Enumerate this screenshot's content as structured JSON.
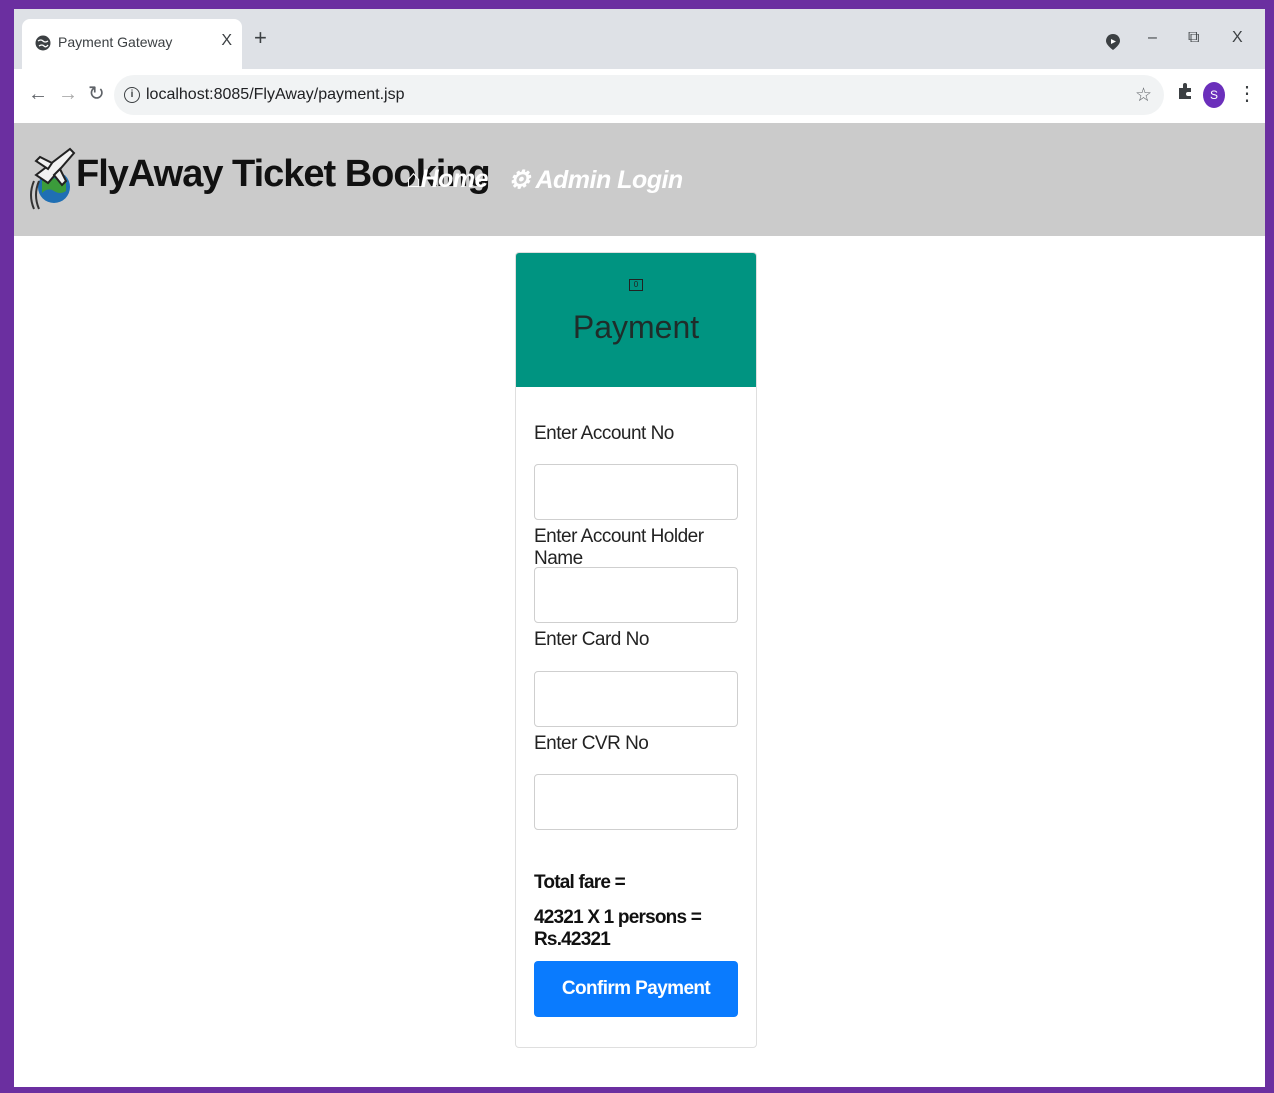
{
  "browser": {
    "tab_title": "Payment Gateway",
    "tab_close": "X",
    "new_tab": "+",
    "window_minimize": "–",
    "window_restore": "⧉",
    "window_close": "X",
    "url": "localhost:8085/FlyAway/payment.jsp",
    "profile_initial": "S"
  },
  "navbar": {
    "brand": "FlyAway Ticket Booking",
    "links": [
      {
        "label": "Home",
        "icon": "home-icon"
      },
      {
        "label": "Admin Login",
        "icon": "gear-icon"
      }
    ]
  },
  "payment_form": {
    "title": "Payment",
    "icon": "money-icon",
    "fields": [
      {
        "label": "Enter Account No",
        "value": "",
        "placeholder": ""
      },
      {
        "label": "Enter Account Holder Name",
        "value": "",
        "placeholder": ""
      },
      {
        "label": "Enter Card No",
        "value": "",
        "placeholder": ""
      },
      {
        "label": "Enter CVR No",
        "value": "",
        "placeholder": ""
      }
    ],
    "total_fare_label": "Total fare =",
    "total_fare_calc": "42321 X 1 persons = Rs.42321",
    "confirm_label": "Confirm Payment"
  },
  "colors": {
    "frame": "#6b2fa0",
    "navbar_bg": "#cbcbcb",
    "card_header": "#009481",
    "confirm_button": "#0a7bfe"
  }
}
